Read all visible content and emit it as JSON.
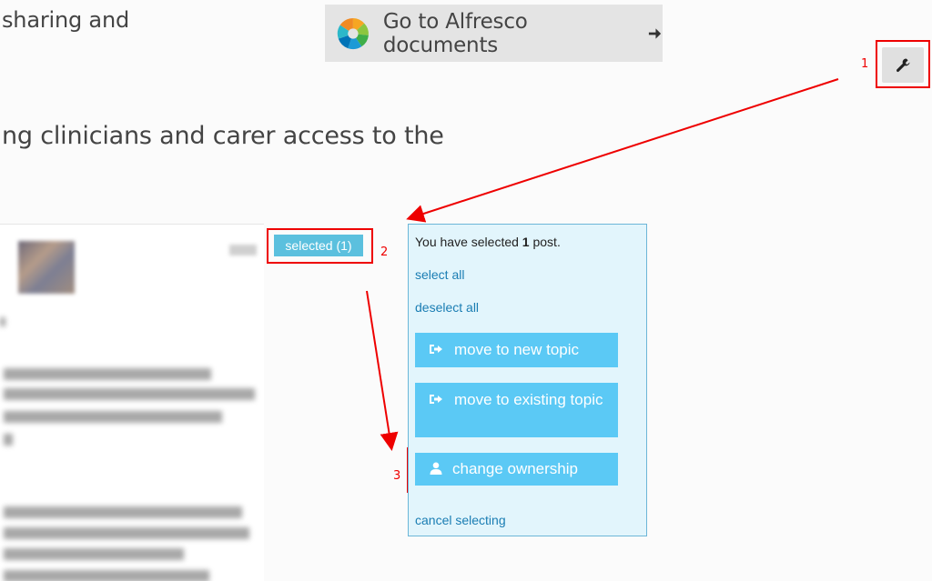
{
  "heading": {
    "line1": "sharing and",
    "line2": "ng clinicians and carer access to the"
  },
  "alfresco_button": {
    "label": "Go to Alfresco documents",
    "icon": "alfresco-logo-icon",
    "arrow_icon": "arrow-right-icon"
  },
  "tools_button": {
    "icon": "wrench-icon"
  },
  "annotations": {
    "n1": "1",
    "n2": "2",
    "n3": "3",
    "color": "#e00000"
  },
  "post": {
    "selected_label": "selected (1)"
  },
  "panel": {
    "msg_prefix": "You have selected ",
    "count": "1",
    "msg_suffix": " post.",
    "select_all": "select all",
    "deselect_all": "deselect all",
    "move_new": "move to new topic",
    "move_existing": "move to existing topic",
    "change_ownership": "change ownership",
    "cancel": "cancel selecting"
  },
  "colors": {
    "accent": "#5bc9f5",
    "link": "#1a7db3",
    "panel_bg": "#e2f5fc",
    "panel_border": "#6cb6d8"
  }
}
